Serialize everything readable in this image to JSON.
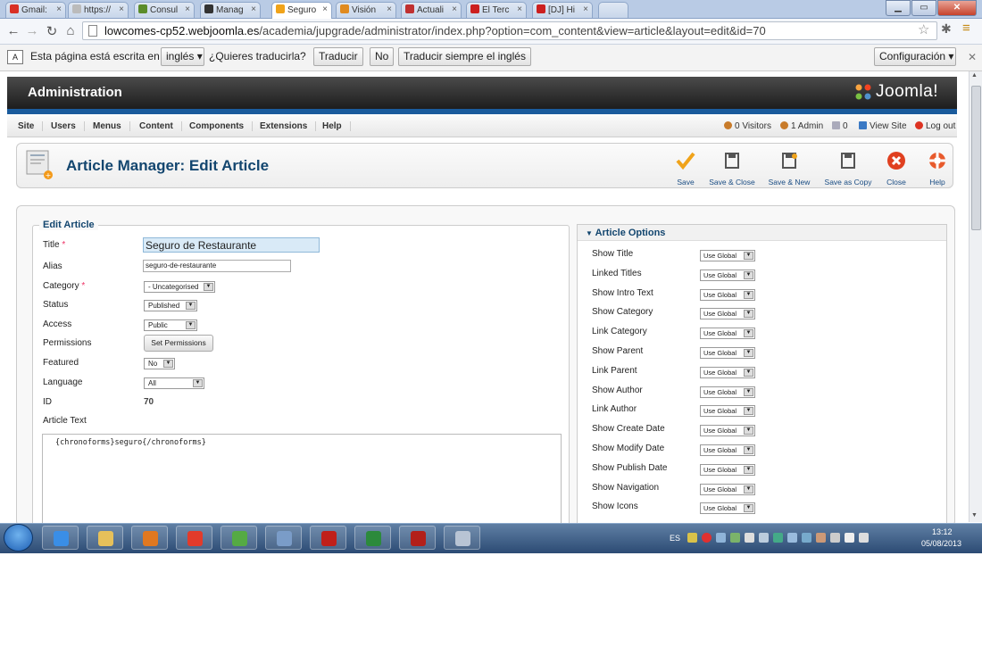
{
  "browser": {
    "tabs": [
      {
        "label": "Gmail:",
        "color": "#d93025"
      },
      {
        "label": "https://",
        "color": "#bbbbbb"
      },
      {
        "label": "Consul",
        "color": "#5b8c2a"
      },
      {
        "label": "Manag",
        "color": "#333333"
      },
      {
        "label": "Seguro",
        "color": "#f0a31a"
      },
      {
        "label": "Visión",
        "color": "#e08a1e"
      },
      {
        "label": "Actuali",
        "color": "#c03030"
      },
      {
        "label": "El Terc",
        "color": "#cc1f1f"
      },
      {
        "label": "[DJ] Hi",
        "color": "#cc1f1f"
      }
    ],
    "url_host": "lowcomes-cp52.webjoomla.es",
    "url_path": "/academia/jupgrade/administrator/index.php?option=com_content&view=article&layout=edit&id=70"
  },
  "translate_bar": {
    "message": "Esta página está escrita en",
    "language": "inglés",
    "question": "¿Quieres traducirla?",
    "translate_btn": "Traducir",
    "no_btn": "No",
    "always_btn": "Traducir siempre el inglés",
    "settings_btn": "Configuración"
  },
  "joomla": {
    "header_title": "Administration",
    "logo_text": "Joomla!",
    "menu": [
      "Site",
      "Users",
      "Menus",
      "Content",
      "Components",
      "Extensions",
      "Help"
    ],
    "status": {
      "visitors": "0 Visitors",
      "admins": "1 Admin",
      "messages": "0",
      "view_site": "View Site",
      "logout": "Log out"
    },
    "page_title": "Article Manager: Edit Article",
    "toolbar": {
      "save": "Save",
      "save_close": "Save & Close",
      "save_new": "Save & New",
      "save_copy": "Save as Copy",
      "close": "Close",
      "help": "Help"
    }
  },
  "edit_article": {
    "legend": "Edit Article",
    "labels": {
      "title": "Title",
      "alias": "Alias",
      "category": "Category",
      "status": "Status",
      "access": "Access",
      "permissions": "Permissions",
      "featured": "Featured",
      "language": "Language",
      "id": "ID",
      "article_text": "Article Text"
    },
    "required_mark": "*",
    "values": {
      "title": "Seguro de Restaurante",
      "alias": "seguro-de-restaurante",
      "category": "- Uncategorised",
      "status": "Published",
      "access": "Public",
      "permissions_btn": "Set Permissions",
      "featured": "No",
      "language": "All",
      "id": "70",
      "article_text": "{chronoforms}seguro{/chronoforms}"
    }
  },
  "article_options": {
    "title": "Article Options",
    "select_value": "Use Global",
    "items": [
      "Show Title",
      "Linked Titles",
      "Show Intro Text",
      "Show Category",
      "Link Category",
      "Show Parent",
      "Link Parent",
      "Show Author",
      "Link Author",
      "Show Create Date",
      "Show Modify Date",
      "Show Publish Date",
      "Show Navigation",
      "Show Icons"
    ]
  },
  "taskbar": {
    "lang": "ES",
    "time": "13:12",
    "date": "05/08/2013"
  }
}
